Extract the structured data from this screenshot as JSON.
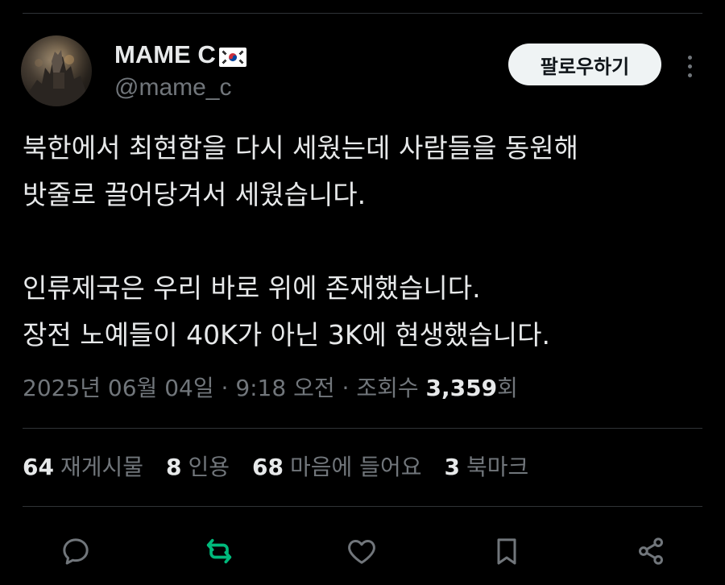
{
  "author": {
    "display_name": "MAME C",
    "flag_icon": "south-korea-flag-icon",
    "handle": "@mame_c"
  },
  "follow_button": {
    "label": "팔로우하기"
  },
  "tweet": {
    "text": "북한에서 최현함을 다시 세웠는데 사람들을 동원해\n밧줄로 끌어당겨서 세웠습니다.\n\n인류제국은 우리 바로 위에 존재했습니다.\n장전 노예들이 40K가 아닌 3K에 현생했습니다."
  },
  "meta": {
    "date": "2025년 06월 04일",
    "separator": " · ",
    "time": "9:18 오전",
    "views_label": "조회수 ",
    "views_count": "3,359",
    "views_suffix": "회"
  },
  "stats": [
    {
      "count": "64",
      "label": "재게시물"
    },
    {
      "count": "8",
      "label": "인용"
    },
    {
      "count": "68",
      "label": "마음에 들어요"
    },
    {
      "count": "3",
      "label": "북마크"
    }
  ],
  "actions": {
    "reply_icon": "reply-icon",
    "repost_icon": "repost-icon",
    "like_icon": "heart-icon",
    "bookmark_icon": "bookmark-icon",
    "share_icon": "share-icon"
  },
  "colors": {
    "background": "#000000",
    "text": "#e7e9ea",
    "secondary_text": "#71767b",
    "divider": "#2f3336",
    "repost_active": "#00ba7c",
    "follow_bg": "#eff3f4"
  }
}
